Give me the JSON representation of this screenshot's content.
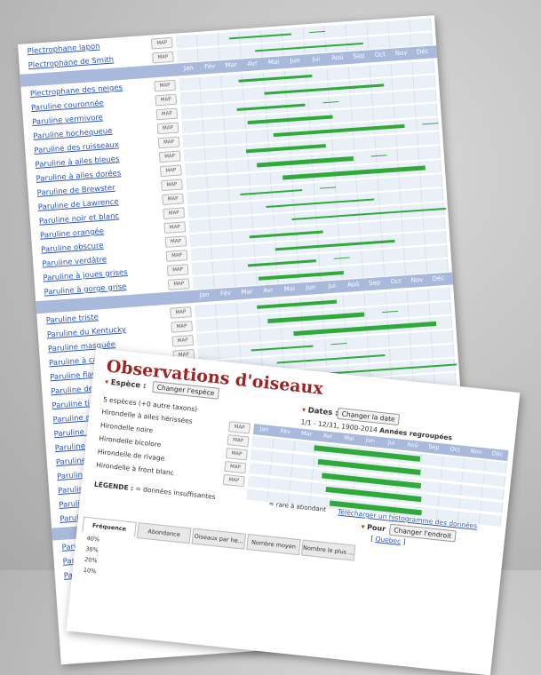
{
  "back": {
    "months": [
      "Jan",
      "Fév",
      "Mar",
      "Avr",
      "Mai",
      "Jun",
      "Jui",
      "Aoû",
      "Sep",
      "Oct",
      "Nov",
      "Déc"
    ],
    "map_label": "MAP",
    "species": [
      "Plectrophane lapon",
      "Plectrophane de Smith",
      "",
      "Plectrophane des neiges",
      "Paruline couronnée",
      "Paruline vermivore",
      "Paruline hochequeue",
      "Paruline des ruisseaux",
      "Paruline à ailes bleues",
      "Paruline à ailes dorées",
      "Paruline de Brewster",
      "Paruline de Lawrence",
      "Paruline noir et blanc",
      "Paruline orangée",
      "Paruline obscure",
      "Paruline verdâtre",
      "Paruline à joues grises",
      "Paruline à gorge grise",
      "",
      "Paruline triste",
      "Paruline du Kentucky",
      "Paruline masquée",
      "Paruline à capuchon",
      "Paruline flamboyante",
      "Paruline de Kirtland",
      "Paruline tigrée",
      "Paruline azurée",
      "Paruline à collier",
      "Paruline à tête",
      "Paruline à poi",
      "Paruline à go",
      "Paruline jaun",
      "Paruline à f",
      "Paruline ra",
      "",
      "Paruline",
      "Paruline",
      "Paruline"
    ]
  },
  "front": {
    "title": "Observations d'oiseaux",
    "espece_label": "Espèce :",
    "change_species_button": "Changer l'espèce",
    "dates_label": "Dates :",
    "change_date_button": "Changer la date",
    "date_range": "1/1 - 12/31, 1900-2014",
    "years_grouped": "Années regroupées",
    "species_count": "5 espèces (+0 autre taxons)",
    "species": [
      "Hirondelle à ailes hérissées",
      "Hirondelle noire",
      "Hirondelle bicolore",
      "Hirondelle de rivage",
      "Hirondelle à front blanc"
    ],
    "months": [
      "Jan",
      "Fév",
      "Mar",
      "Avr",
      "Mai",
      "Jun",
      "Jui",
      "Aoû",
      "Sep",
      "Oct",
      "Nov",
      "Déc"
    ],
    "map_label": "MAP",
    "legend_label": "LÉGENDE :",
    "legend_insufficient": "= données insuffisantes",
    "legend_rare": "= rare à abondant",
    "download_link": "Télécharger un histogramme des données",
    "pour_label": "Pour",
    "change_location_button": "Changer l'endroit",
    "location": "Quebec",
    "tabs": [
      "Fréquence",
      "Abondance",
      "Oiseaux par he...",
      "Nombre moyen",
      "Nombre le plus ..."
    ],
    "y_ticks": [
      "40%",
      "30%",
      "20%",
      "10%"
    ]
  },
  "colors": {
    "bar": "#2faa38",
    "band": "#a8b9dc",
    "title": "#9e2424",
    "link": "#2a56c6"
  }
}
